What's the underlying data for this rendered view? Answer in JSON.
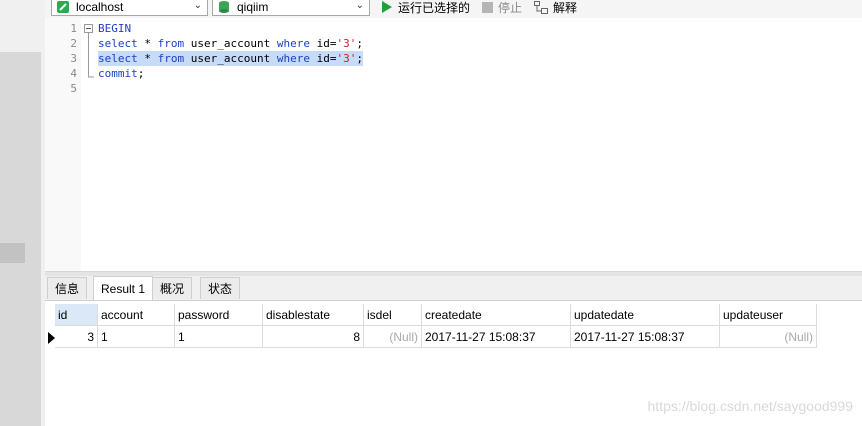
{
  "toolbar": {
    "connection": "localhost",
    "database": "qiqiim",
    "run_selected": "运行已选择的",
    "stop": "停止",
    "explain": "解释"
  },
  "editor": {
    "line_numbers": [
      "1",
      "2",
      "3",
      "4",
      "5"
    ],
    "lines": {
      "l1": {
        "kw": "BEGIN"
      },
      "l2": {
        "a": "select",
        "b": " * ",
        "c": "from",
        "d": " user_account ",
        "e": "where",
        "f": " id=",
        "g": "'3'",
        "h": ";"
      },
      "l3": {
        "a": "select",
        "b": " * ",
        "c": "from",
        "d": " user_account ",
        "e": "where",
        "f": " id=",
        "g": "'3'",
        "h": ";"
      },
      "l4": {
        "kw": "commit",
        "rest": ";"
      }
    }
  },
  "tabs": [
    "信息",
    "Result 1",
    "概况",
    "状态"
  ],
  "active_tab": "Result 1",
  "result": {
    "columns": [
      "id",
      "account",
      "password",
      "disablestate",
      "isdel",
      "createdate",
      "updatedate",
      "updateuser"
    ],
    "rows": [
      [
        "3",
        "1",
        "1",
        "8",
        "(Null)",
        "2017-11-27 15:08:37",
        "2017-11-27 15:08:37",
        "(Null)"
      ]
    ]
  },
  "watermark": "https://blog.csdn.net/saygood999",
  "colors": {
    "keyword": "#1c3fc0",
    "string": "#c1272d",
    "selection": "#c6dbf7",
    "run_icon": "#22a038",
    "null_text": "#a9a9a9"
  }
}
